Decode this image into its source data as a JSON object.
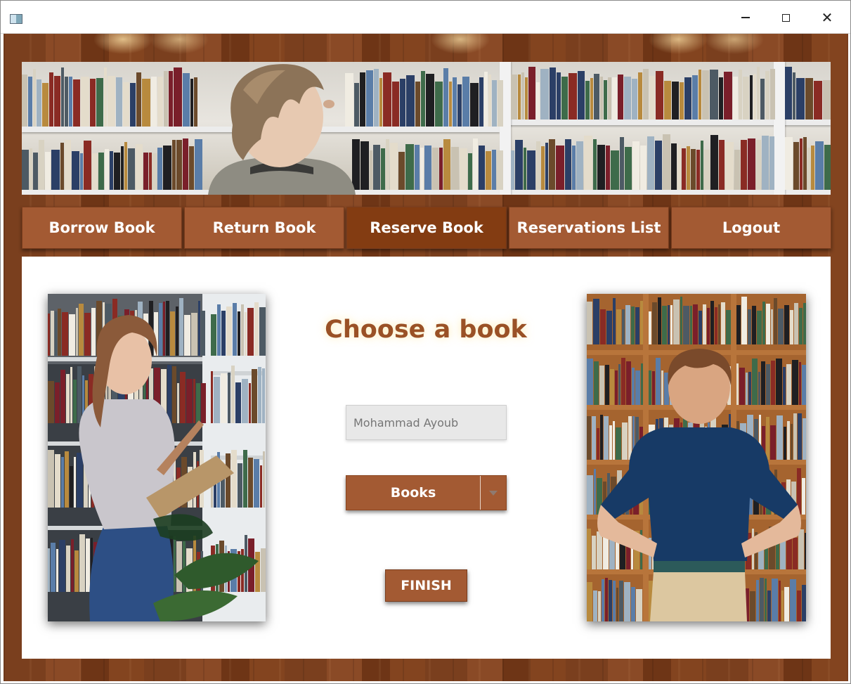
{
  "window": {
    "controls": {
      "minimize": "minimize-icon",
      "maximize": "maximize-icon",
      "close": "close-icon"
    }
  },
  "nav": {
    "items": [
      {
        "label": "Borrow Book",
        "active": false
      },
      {
        "label": "Return Book",
        "active": false
      },
      {
        "label": "Reserve Book",
        "active": true
      },
      {
        "label": "Reservations List",
        "active": false
      },
      {
        "label": "Logout",
        "active": false
      }
    ]
  },
  "main": {
    "heading": "Choose a book",
    "name_field": {
      "value": "",
      "placeholder": "Mohammad Ayoub"
    },
    "book_select": {
      "selected": "Books"
    },
    "finish_label": "FINISH"
  },
  "colors": {
    "button": "#a35a33",
    "button_active": "#833c12",
    "heading": "#9a5126",
    "wood": "#7a3f1e"
  }
}
